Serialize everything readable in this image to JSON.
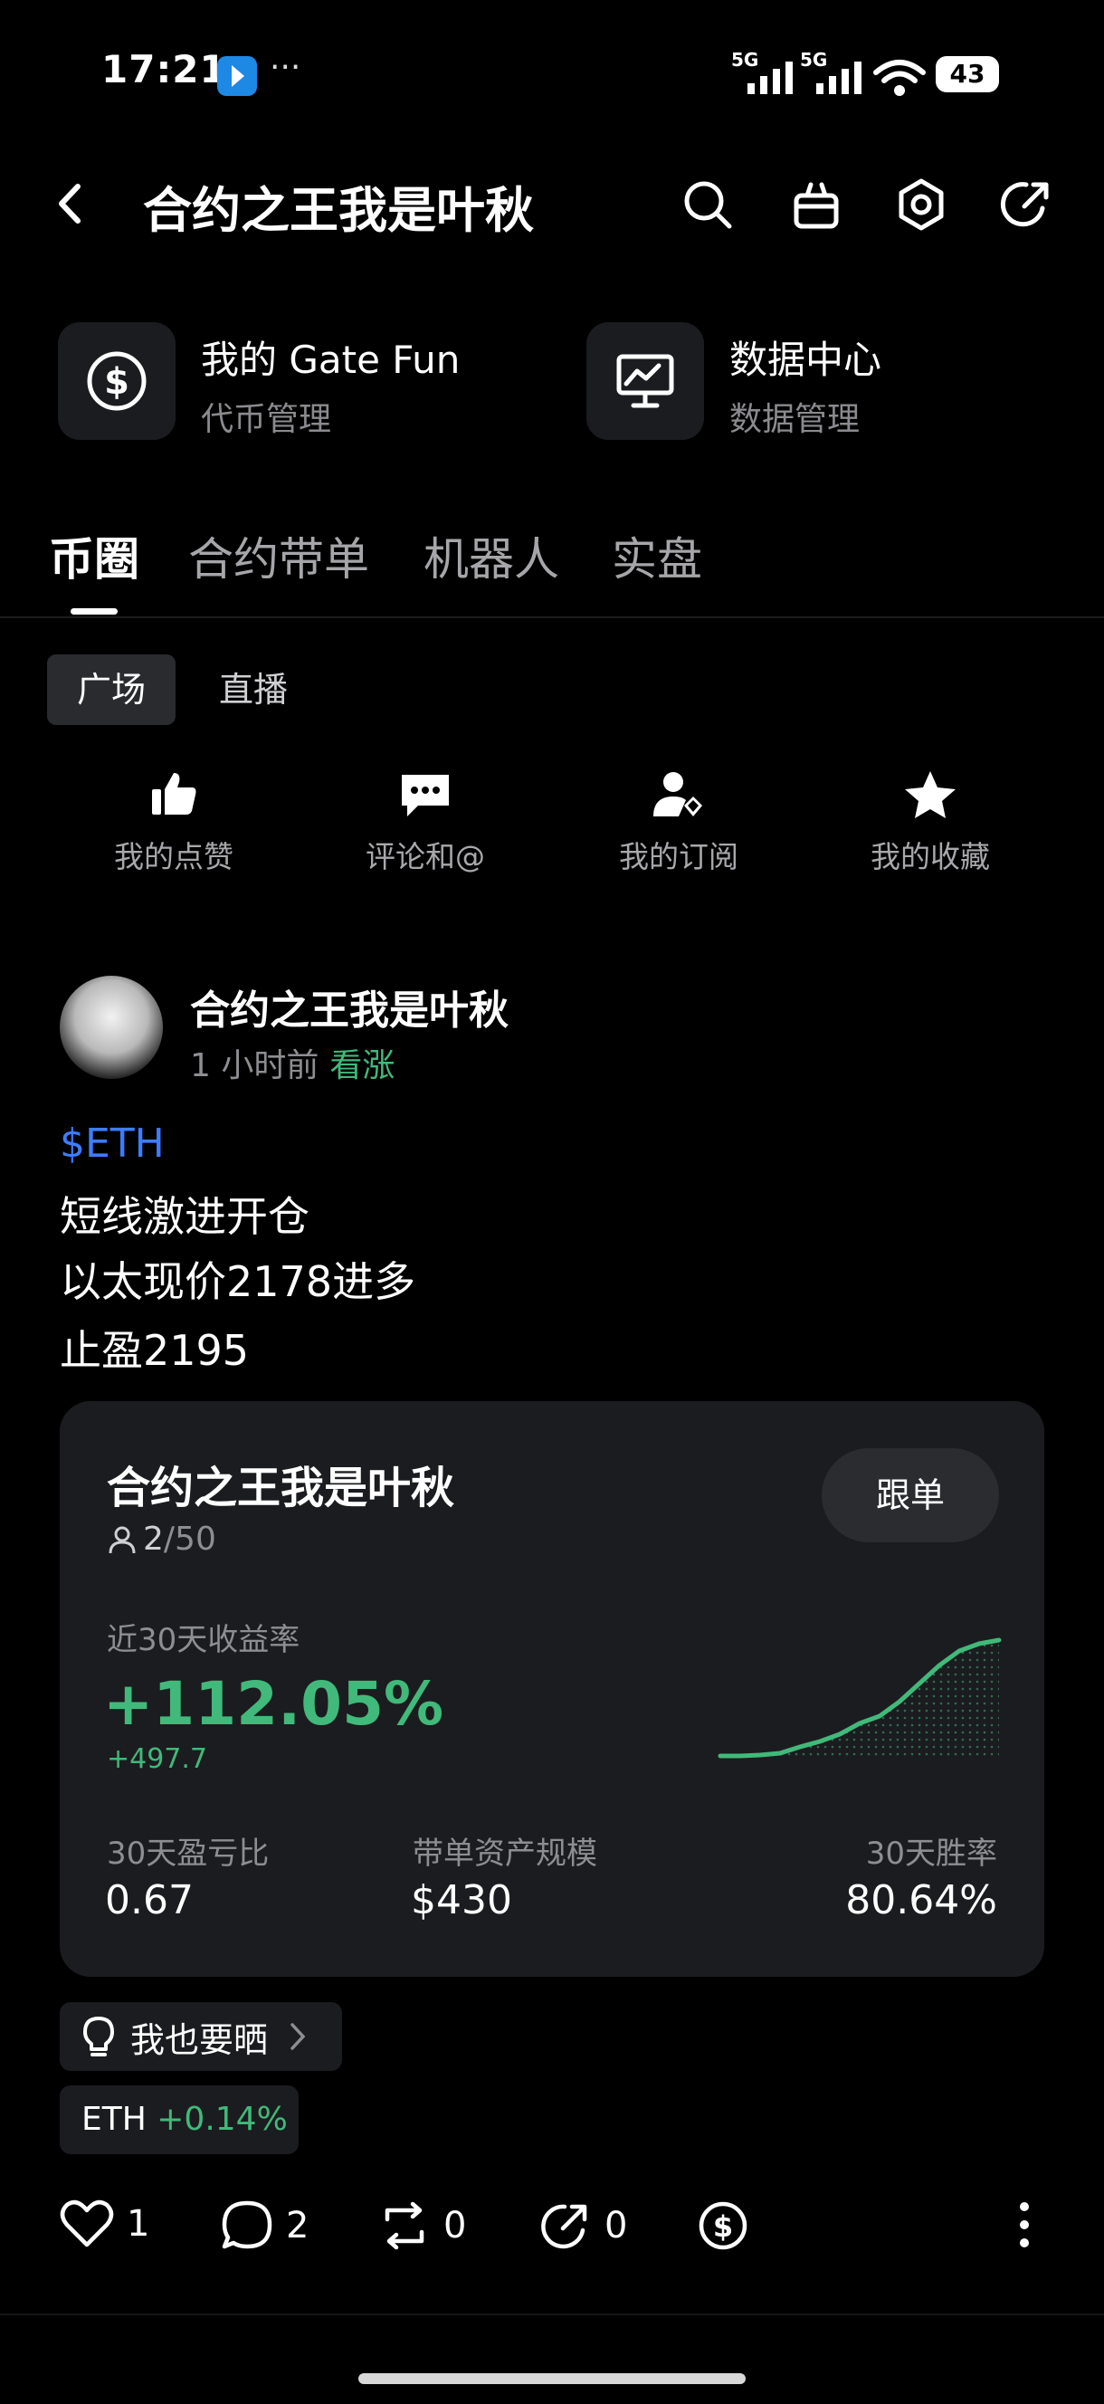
{
  "status_bar": {
    "time": "17:21",
    "more": "···",
    "network1": "5G",
    "network2": "5G",
    "battery": "43"
  },
  "header": {
    "title": "合约之王我是叶秋",
    "icons": [
      "back-icon",
      "search-icon",
      "gift-icon",
      "settings-icon",
      "share-icon"
    ]
  },
  "quick_links": [
    {
      "title": "我的 Gate Fun",
      "subtitle": "代币管理",
      "icon": "dollar-coin-icon"
    },
    {
      "title": "数据中心",
      "subtitle": "数据管理",
      "icon": "monitor-chart-icon"
    }
  ],
  "tabs": [
    {
      "label": "币圈",
      "active": true
    },
    {
      "label": "合约带单",
      "active": false
    },
    {
      "label": "机器人",
      "active": false
    },
    {
      "label": "实盘",
      "active": false
    }
  ],
  "sub_tabs": [
    {
      "label": "广场",
      "active": true
    },
    {
      "label": "直播",
      "active": false
    }
  ],
  "actions": [
    {
      "label": "我的点赞",
      "icon": "thumbs-up-icon"
    },
    {
      "label": "评论和@",
      "icon": "comment-icon"
    },
    {
      "label": "我的订阅",
      "icon": "subscription-icon"
    },
    {
      "label": "我的收藏",
      "icon": "star-icon"
    }
  ],
  "post": {
    "author": "合约之王我是叶秋",
    "time_ago": "1 小时前",
    "sentiment": "看涨",
    "ticker_tag": "$ETH",
    "lines": [
      "短线激进开仓",
      "以太现价2178进多",
      "止盈2195"
    ],
    "card": {
      "title": "合约之王我是叶秋",
      "followers": "2",
      "capacity": "/50",
      "follow_button": "跟单",
      "roi_label": "近30天收益率",
      "roi_value": "+112.05%",
      "pnl_value": "+497.7",
      "stats": [
        {
          "label": "30天盈亏比",
          "value": "0.67"
        },
        {
          "label": "带单资产规模",
          "value": "$430"
        },
        {
          "label": "30天胜率",
          "value": "80.64%"
        }
      ],
      "sparkline": [
        0,
        0,
        0.5,
        1.5,
        5,
        8,
        12,
        18,
        22,
        30,
        40,
        50,
        58,
        62,
        64
      ]
    },
    "share_button": "我也要晒",
    "ticker": {
      "symbol": "ETH",
      "change": "+0.14%"
    },
    "engagement": {
      "likes": "1",
      "comments": "2",
      "reposts": "0",
      "shares": "0"
    }
  },
  "colors": {
    "accent_green": "#41b97a",
    "link_blue": "#3d7dff",
    "card_bg": "#1b1c1f"
  }
}
